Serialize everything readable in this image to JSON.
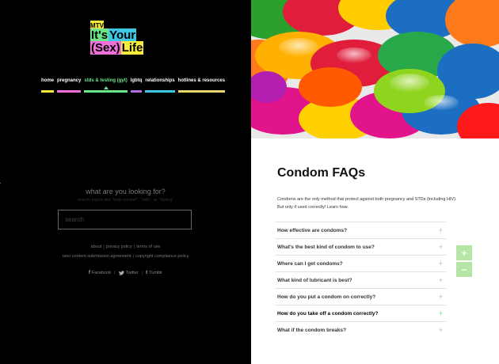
{
  "logo": {
    "mtv": "MTV",
    "line1": [
      "It's",
      "Your"
    ],
    "line2": [
      "(Sex)",
      "Life"
    ]
  },
  "nav": [
    {
      "label": "home",
      "color": "#f7ec3b"
    },
    {
      "label": "pregnancy",
      "color": "#f06fd8"
    },
    {
      "label": "stds & testing (gyt)",
      "color": "#6ee48a",
      "active": true
    },
    {
      "label": "lgbtq",
      "color": "#b06ee6"
    },
    {
      "label": "relationships",
      "color": "#3ec7e5"
    },
    {
      "label": "hotlines & resources",
      "color": "#e8d56b"
    }
  ],
  "search": {
    "title": "what are you looking for?",
    "hint": "search topics like \"birth control\", \"stds\", or \"dating\"",
    "placeholder": "search"
  },
  "footer": {
    "about": "about",
    "privacy": "privacy policy",
    "terms": "terms of use",
    "ucsa": "user content submission agreement",
    "copyright": "copyright compliance policy"
  },
  "social": {
    "facebook": "Facebook",
    "twitter": "Twitter",
    "tumblr": "Tumblr"
  },
  "faq": {
    "title": "Condom FAQs",
    "intro": "Condoms are the only method that protect against both pregnancy and STDs (including HIV). But only if used correctly! Learn how.",
    "items": [
      {
        "q": "How effective are condoms?"
      },
      {
        "q": "What's the best kind of condom to use?"
      },
      {
        "q": "Where can I get condoms?"
      },
      {
        "q": "What kind of lubricant is best?"
      },
      {
        "q": "How do you put a condom on correctly?"
      },
      {
        "q": "How do you take off a condom correctly?",
        "active": true
      },
      {
        "q": "What if the condom breaks?"
      }
    ]
  },
  "zoom": {
    "in": "+",
    "out": "−"
  },
  "colors": {
    "accent_green": "#6ee48a",
    "zoom_bg": "#b6e6a6"
  }
}
